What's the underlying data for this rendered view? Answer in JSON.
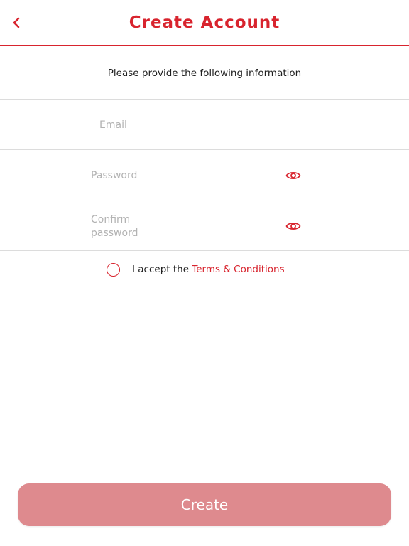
{
  "header": {
    "title": "Create Account",
    "back_icon": "chevron-left-icon"
  },
  "intro": {
    "text": "Please provide the following information"
  },
  "form": {
    "email": {
      "value": "",
      "placeholder": "Email"
    },
    "password": {
      "value": "",
      "placeholder": "Password",
      "toggle_icon": "eye-icon"
    },
    "confirm_password": {
      "value": "",
      "placeholder": "Confirm password",
      "toggle_icon": "eye-icon"
    }
  },
  "terms": {
    "checked": false,
    "prefix": "I accept the ",
    "link": "Terms & Conditions"
  },
  "actions": {
    "create_label": "Create"
  },
  "colors": {
    "accent": "#d8242e",
    "button_disabled": "#de8a8e",
    "divider": "#dcdcdc",
    "placeholder": "#b3b3b3"
  }
}
